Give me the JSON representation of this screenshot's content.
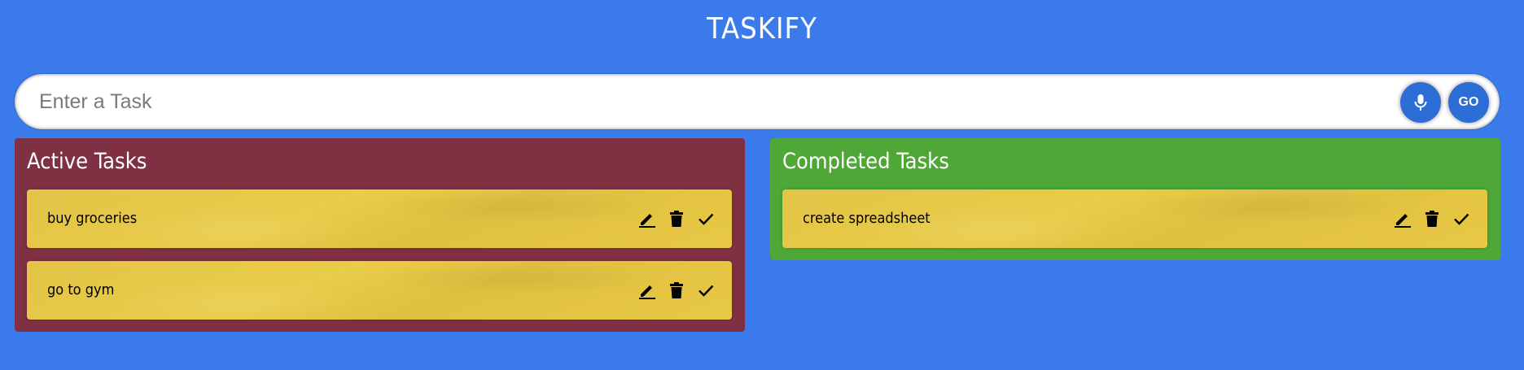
{
  "app": {
    "title": "TASKIFY"
  },
  "search": {
    "placeholder": "Enter a Task",
    "value": "",
    "mic_icon": "microphone-icon",
    "go_label": "GO"
  },
  "active": {
    "title": "Active Tasks",
    "tasks": [
      {
        "text": "buy groceries"
      },
      {
        "text": "go to gym"
      }
    ]
  },
  "completed": {
    "title": "Completed Tasks",
    "tasks": [
      {
        "text": "create spreadsheet"
      }
    ]
  },
  "task_actions": {
    "edit_icon": "pencil-icon",
    "delete_icon": "trash-icon",
    "done_icon": "check-icon"
  },
  "colors": {
    "background": "#3a7aea",
    "active_panel": "#7f3042",
    "completed_panel": "#4ea737",
    "task_card": "#e6c745",
    "button": "#2c6dd6"
  }
}
